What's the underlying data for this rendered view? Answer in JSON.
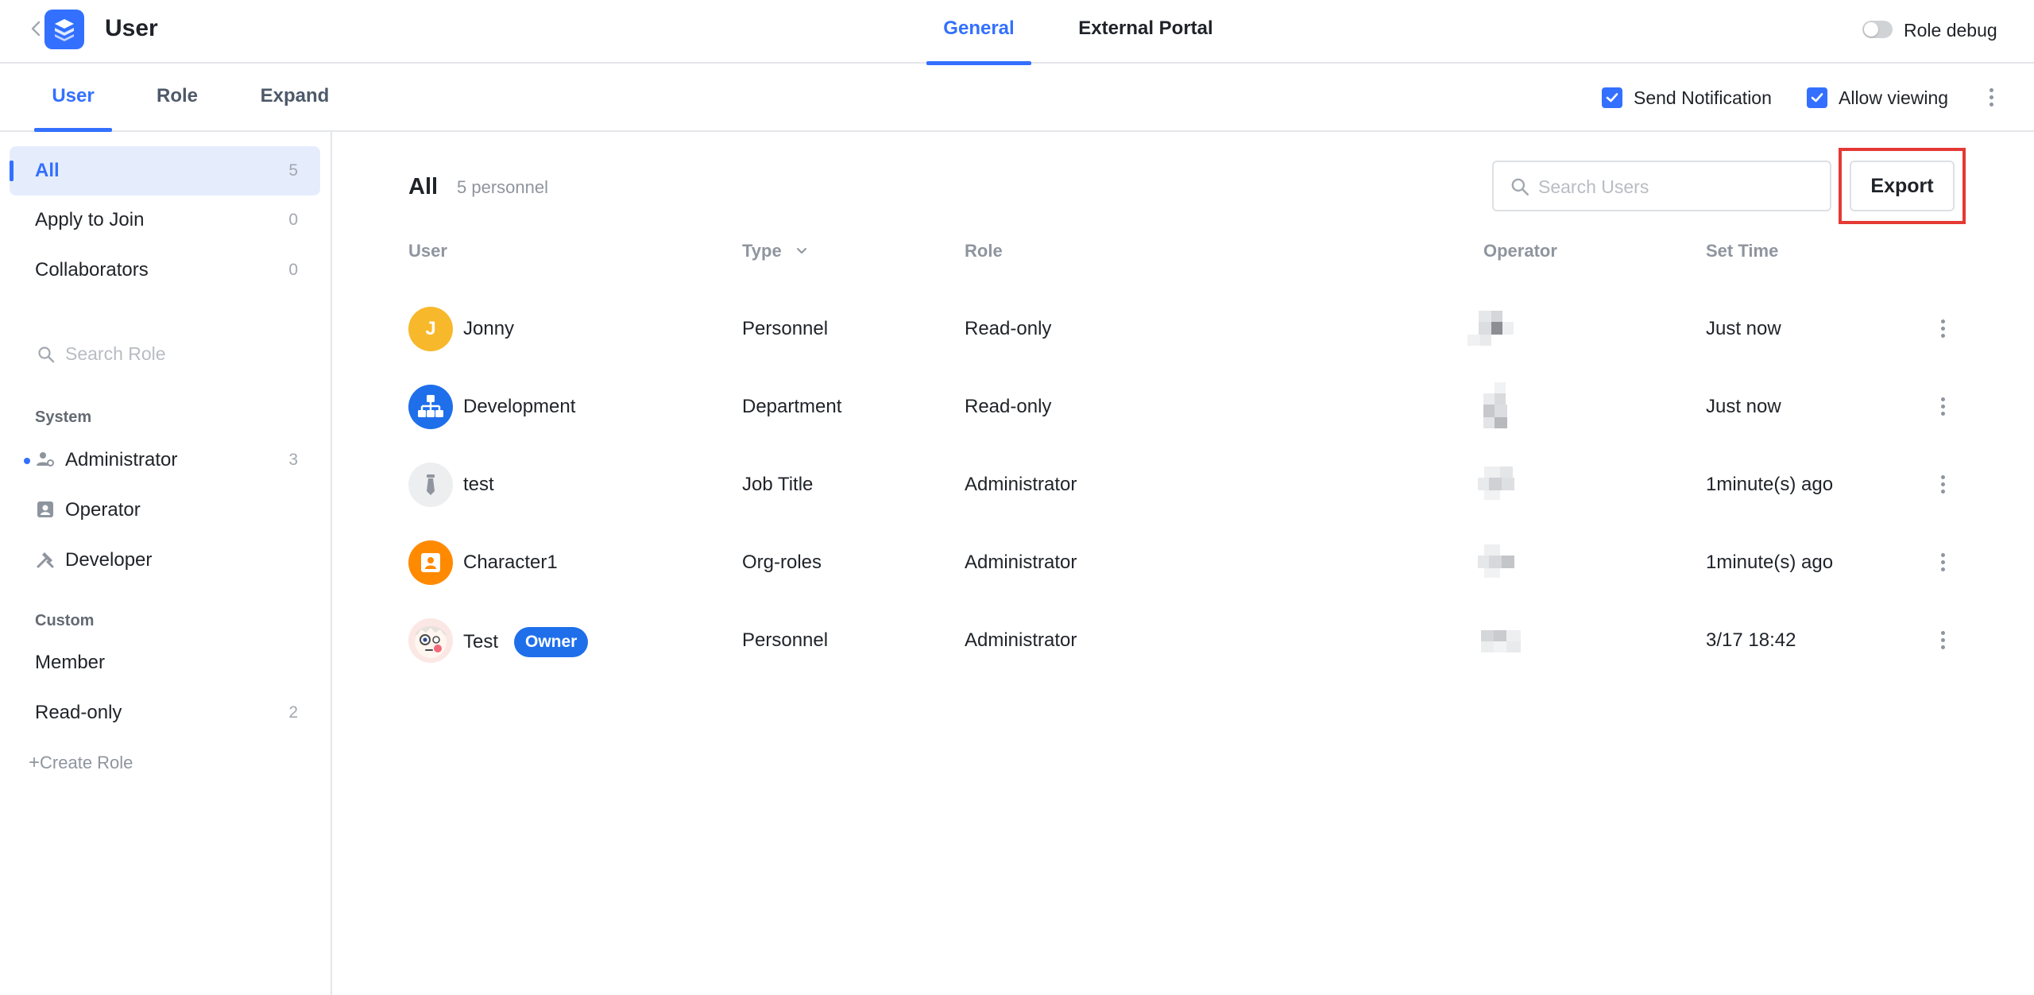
{
  "header": {
    "title": "User",
    "tabs": [
      {
        "label": "General",
        "active": true
      },
      {
        "label": "External Portal",
        "active": false
      }
    ],
    "role_debug_label": "Role debug",
    "role_debug_on": false
  },
  "subnav": {
    "tabs": [
      {
        "label": "User",
        "active": true
      },
      {
        "label": "Role",
        "active": false
      },
      {
        "label": "Expand",
        "active": false
      }
    ],
    "send_notification": {
      "label": "Send Notification",
      "checked": true
    },
    "allow_viewing": {
      "label": "Allow viewing",
      "checked": true
    }
  },
  "sidebar": {
    "filters": [
      {
        "label": "All",
        "count": "5",
        "active": true
      },
      {
        "label": "Apply to Join",
        "count": "0"
      },
      {
        "label": "Collaborators",
        "count": "0"
      }
    ],
    "search_placeholder": "Search Role",
    "system_group": "System",
    "system_roles": [
      {
        "label": "Administrator",
        "count": "3",
        "icon": "admin-icon"
      },
      {
        "label": "Operator",
        "count": "",
        "icon": "operator-icon"
      },
      {
        "label": "Developer",
        "count": "",
        "icon": "developer-icon"
      }
    ],
    "custom_group": "Custom",
    "custom_roles": [
      {
        "label": "Member",
        "count": ""
      },
      {
        "label": "Read-only",
        "count": "2"
      }
    ],
    "create_role": "Create Role"
  },
  "main": {
    "title": "All",
    "count_label": "5 personnel",
    "search_placeholder": "Search Users",
    "export_label": "Export",
    "columns": {
      "user": "User",
      "type": "Type",
      "role": "Role",
      "operator": "Operator",
      "set_time": "Set Time"
    },
    "rows": [
      {
        "name": "Jonny",
        "type": "Personnel",
        "role": "Read-only",
        "time": "Just now",
        "avatar": "J",
        "avatar_color": "#f7b82b",
        "owner": false
      },
      {
        "name": "Development",
        "type": "Department",
        "role": "Read-only",
        "time": "Just now",
        "avatar": "",
        "avatar_color": "#1f6feb",
        "owner": false
      },
      {
        "name": "test",
        "type": "Job Title",
        "role": "Administrator",
        "time": "1minute(s) ago",
        "avatar": "",
        "avatar_color": "#eceef0",
        "owner": false
      },
      {
        "name": "Character1",
        "type": "Org-roles",
        "role": "Administrator",
        "time": "1minute(s) ago",
        "avatar": "",
        "avatar_color": "#ff8a00",
        "owner": false
      },
      {
        "name": "Test",
        "type": "Personnel",
        "role": "Administrator",
        "time": "3/17 18:42",
        "avatar": "",
        "avatar_color": "#fbe7e4",
        "owner": true,
        "owner_label": "Owner"
      }
    ]
  },
  "colors": {
    "accent": "#3370ff",
    "highlight_box": "#e53935"
  }
}
